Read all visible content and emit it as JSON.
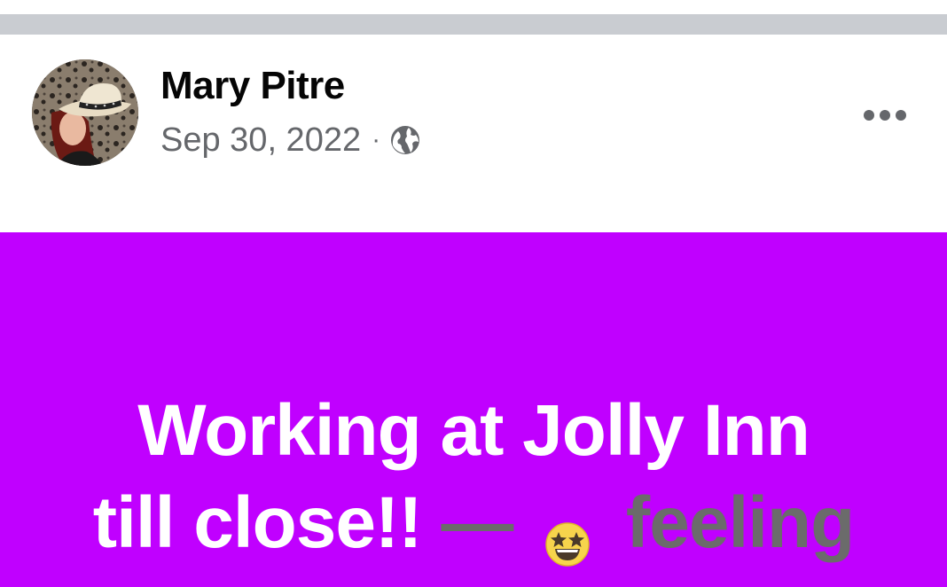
{
  "post": {
    "author": "Mary Pitre",
    "date": "Sep 30, 2022",
    "separator": "·",
    "audience_icon": "globe-icon",
    "more_icon": "more-options-icon"
  },
  "status": {
    "line1": "Working at Jolly Inn",
    "line2_text": "till close!!",
    "dash": "—",
    "feeling_emoji": "star-struck-emoji",
    "feeling_word": "feeling",
    "background_color": "#c000ff",
    "text_color": "#ffffff",
    "feeling_color": "#6b6b6b"
  },
  "colors": {
    "divider": "#c9ccd1",
    "name": "#050505",
    "meta": "#65676b"
  }
}
